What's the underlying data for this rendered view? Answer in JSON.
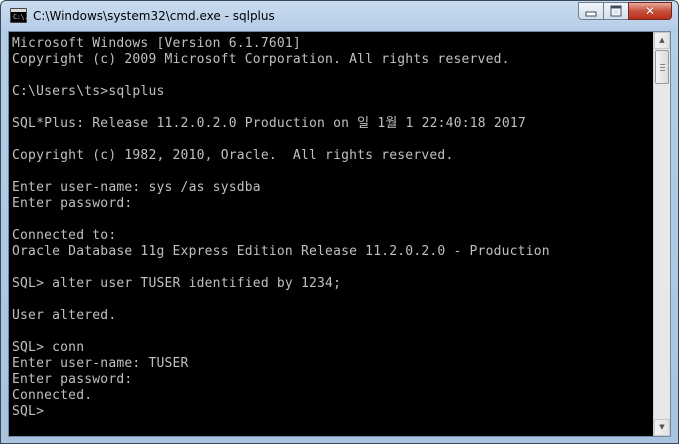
{
  "window": {
    "title": "C:\\Windows\\system32\\cmd.exe - sqlplus",
    "icon_text": "C:\\."
  },
  "caption_buttons": {
    "minimize": "minimize-icon",
    "maximize": "maximize-icon",
    "close": "close-icon",
    "close_glyph": "✕"
  },
  "scrollbar": {
    "up_glyph": "▲",
    "down_glyph": "▼"
  },
  "console": {
    "lines": [
      "Microsoft Windows [Version 6.1.7601]",
      "Copyright (c) 2009 Microsoft Corporation. All rights reserved.",
      "",
      "C:\\Users\\ts>sqlplus",
      "",
      "SQL*Plus: Release 11.2.0.2.0 Production on 일 1월 1 22:40:18 2017",
      "",
      "Copyright (c) 1982, 2010, Oracle.  All rights reserved.",
      "",
      "Enter user-name: sys /as sysdba",
      "Enter password:",
      "",
      "Connected to:",
      "Oracle Database 11g Express Edition Release 11.2.0.2.0 - Production",
      "",
      "SQL> alter user TUSER identified by 1234;",
      "",
      "User altered.",
      "",
      "SQL> conn",
      "Enter user-name: TUSER",
      "Enter password:",
      "Connected.",
      "SQL>"
    ]
  }
}
